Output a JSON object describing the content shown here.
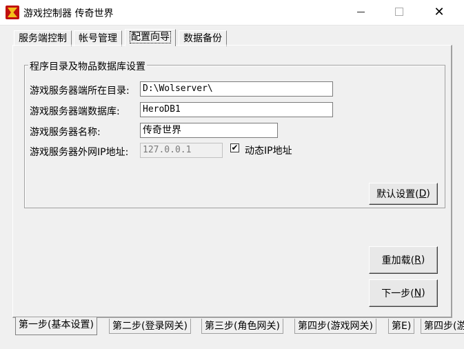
{
  "window": {
    "title": "游戏控制器  传奇世界",
    "close_glyph": "✕"
  },
  "top_tabs": [
    {
      "label": "服务端控制"
    },
    {
      "label": "帐号管理"
    },
    {
      "label": "配置向导"
    },
    {
      "label": "数据备份"
    }
  ],
  "group": {
    "title": "程序目录及物品数据库设置"
  },
  "fields": {
    "dir_label": "游戏服务器端所在目录:",
    "dir_value": "D:\\Wolserver\\",
    "db_label": "游戏服务器端数据库:",
    "db_value": "HeroDB1",
    "name_label": "游戏服务器名称:",
    "name_value": "传奇世界",
    "ip_label": "游戏服务器外网IP地址:",
    "ip_value": "127.0.0.1",
    "dynamic_ip_label": "动态IP地址",
    "dynamic_ip_checked": true,
    "check_glyph": "✔"
  },
  "buttons": {
    "default_settings": "默认设置(",
    "default_settings_key": "D",
    "reload": "重加载(",
    "reload_key": "R",
    "next": "下一步(",
    "next_key": "N",
    "close_paren": ")"
  },
  "bottom_tabs": [
    {
      "label": "第一步(基本设置)"
    },
    {
      "label": "第二步(登录网关)"
    },
    {
      "label": "第三步(角色网关)"
    },
    {
      "label": "第四步(游戏网关)"
    },
    {
      "label": "第E)"
    },
    {
      "label": "第四步(游"
    }
  ]
}
